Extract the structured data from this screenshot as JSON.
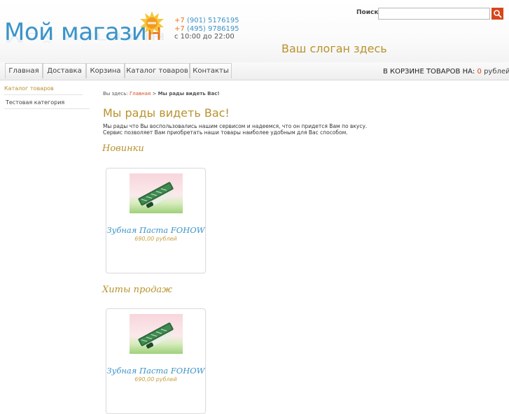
{
  "header": {
    "logo_main": "Мой магази",
    "logo_last": "н",
    "phone1_prefix": "+7",
    "phone1": "(901) 5176195",
    "phone2_prefix": "+7",
    "phone2": "(495) 9786195",
    "hours": "с 10:00 до 22:00",
    "slogan": "Ваш слоган здесь"
  },
  "search": {
    "label": "Поиск",
    "value": "",
    "placeholder": ""
  },
  "nav": [
    "Главная",
    "Доставка",
    "Корзина",
    "Каталог товаров",
    "Контакты"
  ],
  "cart": {
    "label": "В КОРЗИНЕ ТОВАРОВ НА:",
    "amount": "0",
    "currency": "рублей"
  },
  "sidebar": {
    "title": "Каталог товаров",
    "categories": [
      "Тестовая категория"
    ]
  },
  "breadcrumb": {
    "prefix": "Вы здесь:",
    "home": "Главная",
    "separator": ">",
    "current": "Мы рады видеть Вас!"
  },
  "main": {
    "title": "Мы рады видеть Вас!",
    "intro_line1": "Мы рады что Вы воспользовались нашим сервисом и надеемся, что он придется Вам по вкусу.",
    "intro_line2": "Сервис позволяет Вам приобретать наши товары наиболее удобным для Вас способом."
  },
  "sections": [
    {
      "title": "Новинки",
      "products": [
        {
          "name": "Зубная Паста FOHOW",
          "price": "690,00 рублей"
        }
      ]
    },
    {
      "title": "Хиты продаж",
      "products": [
        {
          "name": "Зубная Паста FOHOW",
          "price": "690,00 рублей"
        }
      ]
    }
  ],
  "colors": {
    "accent_blue": "#3b93c9",
    "accent_orange": "#e8741a",
    "accent_gold": "#b8922e",
    "accent_red": "#d6461b"
  },
  "icons": {
    "search_button": "search-icon",
    "logo_badge": "sunburst-badge-icon"
  }
}
